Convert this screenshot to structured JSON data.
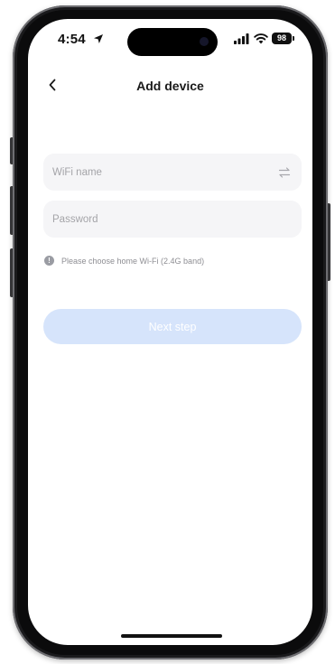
{
  "status_bar": {
    "time": "4:54",
    "battery": "98"
  },
  "header": {
    "title": "Add device"
  },
  "form": {
    "wifi_name": {
      "value": "",
      "placeholder": "WiFi name"
    },
    "password": {
      "value": "",
      "placeholder": "Password"
    },
    "hint": "Please choose home Wi-Fi (2.4G band)",
    "next_label": "Next step"
  },
  "icons": {
    "back": "chevron-left-icon",
    "switch_network": "switch-arrows-icon",
    "info": "info-icon"
  },
  "colors": {
    "next_button_disabled": "#d6e4fb",
    "field_background": "#f5f5f7",
    "hint_text": "#8e8e93"
  }
}
